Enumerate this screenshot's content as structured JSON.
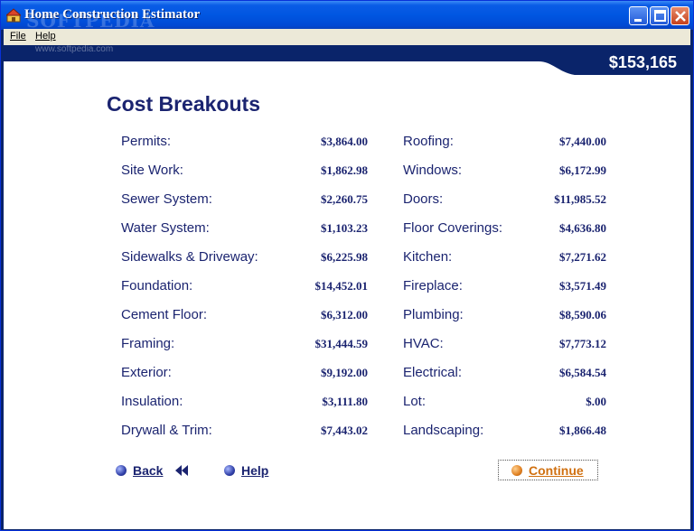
{
  "window": {
    "title": "Home Construction Estimator",
    "watermark": "SOFTPEDIA",
    "watermark_url": "www.softpedia.com"
  },
  "menu": {
    "file": "File",
    "help": "Help"
  },
  "total": "$153,165",
  "heading": "Cost Breakouts",
  "left_items": [
    {
      "label": "Permits:",
      "value": "$3,864.00"
    },
    {
      "label": "Site Work:",
      "value": "$1,862.98"
    },
    {
      "label": "Sewer System:",
      "value": "$2,260.75"
    },
    {
      "label": "Water System:",
      "value": "$1,103.23"
    },
    {
      "label": "Sidewalks & Driveway:",
      "value": "$6,225.98"
    },
    {
      "label": "Foundation:",
      "value": "$14,452.01"
    },
    {
      "label": "Cement Floor:",
      "value": "$6,312.00"
    },
    {
      "label": "Framing:",
      "value": "$31,444.59"
    },
    {
      "label": "Exterior:",
      "value": "$9,192.00"
    },
    {
      "label": "Insulation:",
      "value": "$3,111.80"
    },
    {
      "label": "Drywall & Trim:",
      "value": "$7,443.02"
    }
  ],
  "right_items": [
    {
      "label": "Roofing:",
      "value": "$7,440.00"
    },
    {
      "label": "Windows:",
      "value": "$6,172.99"
    },
    {
      "label": "Doors:",
      "value": "$11,985.52"
    },
    {
      "label": "Floor Coverings:",
      "value": "$4,636.80"
    },
    {
      "label": "Kitchen:",
      "value": "$7,271.62"
    },
    {
      "label": "Fireplace:",
      "value": "$3,571.49"
    },
    {
      "label": "Plumbing:",
      "value": "$8,590.06"
    },
    {
      "label": "HVAC:",
      "value": "$7,773.12"
    },
    {
      "label": "Electrical:",
      "value": "$6,584.54"
    },
    {
      "label": "Lot:",
      "value": "$.00"
    },
    {
      "label": "Landscaping:",
      "value": "$1,866.48"
    }
  ],
  "nav": {
    "back": "Back",
    "help": "Help",
    "continue": "Continue"
  },
  "colors": {
    "titlebar": "#0054e3",
    "banner": "#0a246a",
    "text": "#1b2470",
    "continue": "#d07010"
  }
}
